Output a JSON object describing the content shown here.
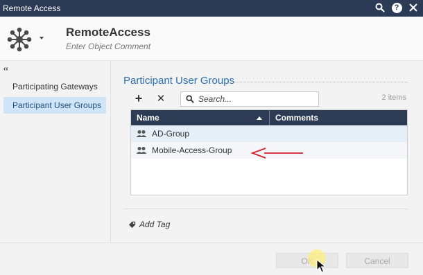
{
  "window": {
    "title": "Remote Access"
  },
  "header": {
    "name": "RemoteAccess",
    "comment_placeholder": "Enter Object Comment"
  },
  "sidebar": {
    "collapse_glyph": "‹‹",
    "items": [
      {
        "label": "Participating Gateways",
        "active": false
      },
      {
        "label": "Participant User Groups",
        "active": true
      }
    ]
  },
  "main": {
    "section_title": "Participant User Groups",
    "toolbar": {
      "add_glyph": "+",
      "remove_glyph": "✕"
    },
    "search": {
      "placeholder": "Search..."
    },
    "items_count": "2 items",
    "table": {
      "columns": [
        "Name",
        "Comments"
      ],
      "rows": [
        {
          "name": "AD-Group"
        },
        {
          "name": "Mobile-Access-Group"
        }
      ]
    },
    "add_tag_label": "Add Tag"
  },
  "footer": {
    "ok_label": "OK",
    "cancel_label": "Cancel"
  },
  "colors": {
    "titlebar": "#2b3a55",
    "accent": "#2a6fb0",
    "selected_sidebar": "#cfe4f6",
    "arrow": "#d0202a"
  }
}
